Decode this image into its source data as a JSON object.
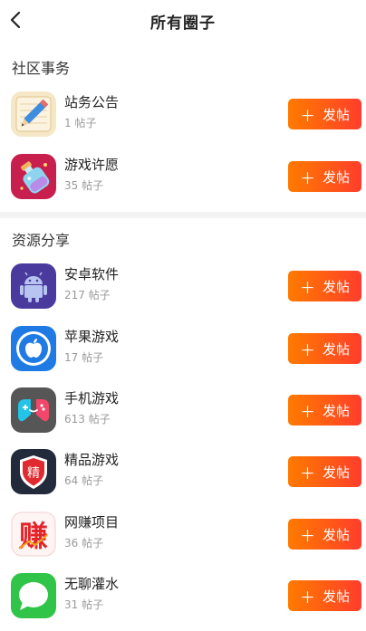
{
  "header": {
    "title": "所有圈子"
  },
  "sections": [
    {
      "title": "社区事务",
      "items": [
        {
          "name": "站务公告",
          "count": "1 帖子",
          "icon": "pencil-notepad-icon",
          "button": "发帖"
        },
        {
          "name": "游戏许愿",
          "count": "35 帖子",
          "icon": "wish-bottle-icon",
          "button": "发帖"
        }
      ]
    },
    {
      "title": "资源分享",
      "items": [
        {
          "name": "安卓软件",
          "count": "217 帖子",
          "icon": "android-icon",
          "button": "发帖"
        },
        {
          "name": "苹果游戏",
          "count": "17 帖子",
          "icon": "apple-icon",
          "button": "发帖"
        },
        {
          "name": "手机游戏",
          "count": "613 帖子",
          "icon": "gamepad-icon",
          "button": "发帖"
        },
        {
          "name": "精品游戏",
          "count": "64 帖子",
          "icon": "shield-badge-icon",
          "badge_char": "精",
          "button": "发帖"
        },
        {
          "name": "网赚项目",
          "count": "36 帖子",
          "icon": "earn-icon",
          "badge_char": "赚",
          "button": "发帖"
        },
        {
          "name": "无聊灌水",
          "count": "31 帖子",
          "icon": "chat-bubble-icon",
          "button": "发帖"
        }
      ]
    }
  ],
  "colors": {
    "button_start": "#ff7a00",
    "button_end": "#ff3d2c"
  }
}
